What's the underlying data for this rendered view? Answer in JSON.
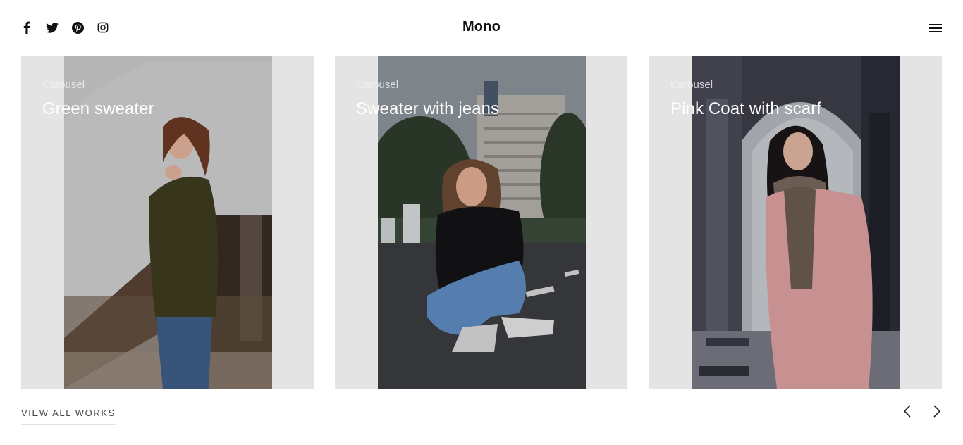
{
  "header": {
    "brand": "Mono",
    "social": [
      "facebook-icon",
      "twitter-icon",
      "pinterest-icon",
      "instagram-icon"
    ],
    "menu_icon": "hamburger-menu-icon"
  },
  "carousel": {
    "cards": [
      {
        "tag": "Carousel",
        "title": "Green sweater"
      },
      {
        "tag": "Carousel",
        "title": "Sweater with jeans"
      },
      {
        "tag": "Carousel",
        "title": "Pink Coat with scarf"
      }
    ],
    "prev_icon": "chevron-left-icon",
    "next_icon": "chevron-right-icon"
  },
  "footer": {
    "view_all": "VIEW ALL WORKS"
  },
  "colors": {
    "card_bg": "#e4e4e4",
    "text_dark": "#111111",
    "text_light": "#ffffff"
  }
}
